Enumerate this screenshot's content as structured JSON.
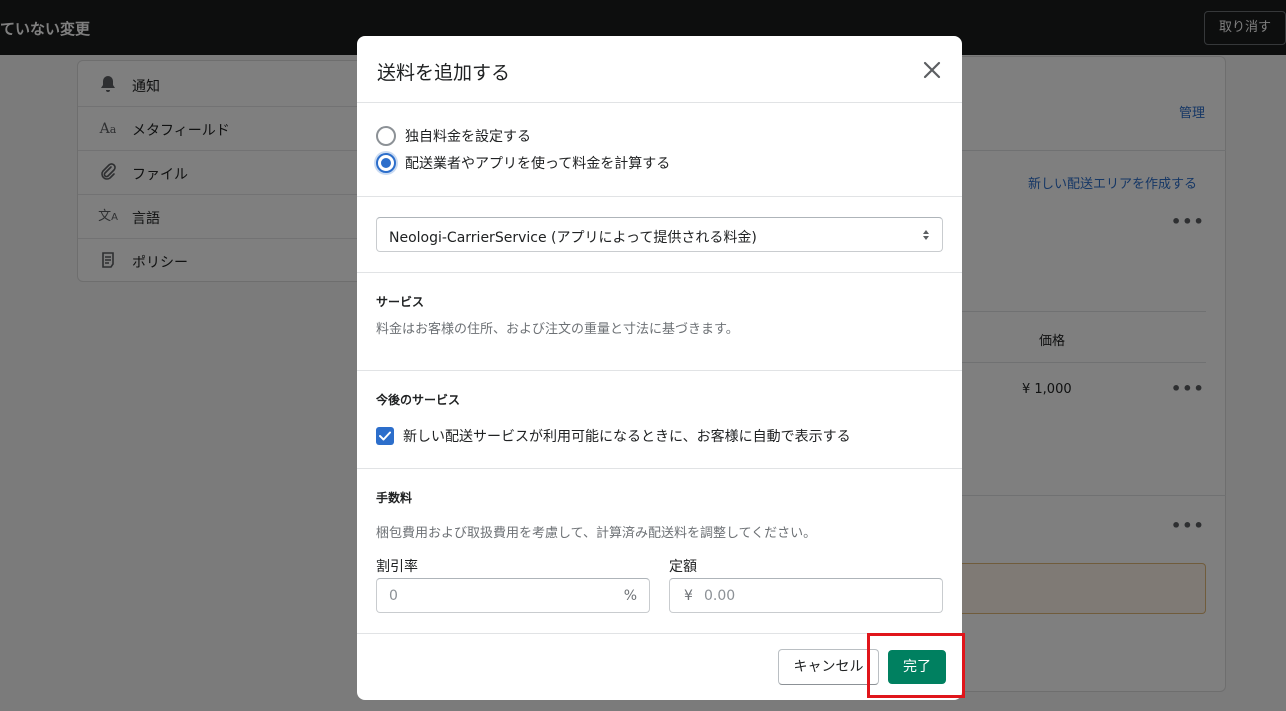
{
  "topbar": {
    "title": "ていない変更",
    "discard_label": "取り消す"
  },
  "sidebar": {
    "items": [
      {
        "label": "通知",
        "icon": "bell-icon"
      },
      {
        "label": "メタフィールド",
        "icon": "metafield-icon"
      },
      {
        "label": "ファイル",
        "icon": "paperclip-icon"
      },
      {
        "label": "言語",
        "icon": "translate-icon"
      },
      {
        "label": "ポリシー",
        "icon": "policy-icon"
      }
    ]
  },
  "background": {
    "manage_link": "管理",
    "create_zone_link": "新しい配送エリアを作成する",
    "price_header": "価格",
    "price_value": "¥ 1,000"
  },
  "modal": {
    "title": "送料を追加する",
    "radio_custom": "独自料金を設定する",
    "radio_carrier": "配送業者やアプリを使って料金を計算する",
    "carrier_select": "Neologi-CarrierService (アプリによって提供される料金)",
    "services_heading": "サービス",
    "services_text": "料金はお客様の住所、および注文の重量と寸法に基づきます。",
    "future_heading": "今後のサービス",
    "future_checkbox": "新しい配送サービスが利用可能になるときに、お客様に自動で表示する",
    "fee_heading": "手数料",
    "fee_text": "梱包費用および取扱費用を考慮して、計算済み配送料を調整してください。",
    "discount_label": "割引率",
    "discount_value": "0",
    "discount_suffix": "%",
    "fixed_label": "定額",
    "fixed_prefix": "¥",
    "fixed_value": "0.00",
    "cancel_label": "キャンセル",
    "done_label": "完了"
  },
  "colors": {
    "primary_green": "#008060",
    "accent_blue": "#2c6ecb",
    "highlight_red": "#e0151b"
  }
}
